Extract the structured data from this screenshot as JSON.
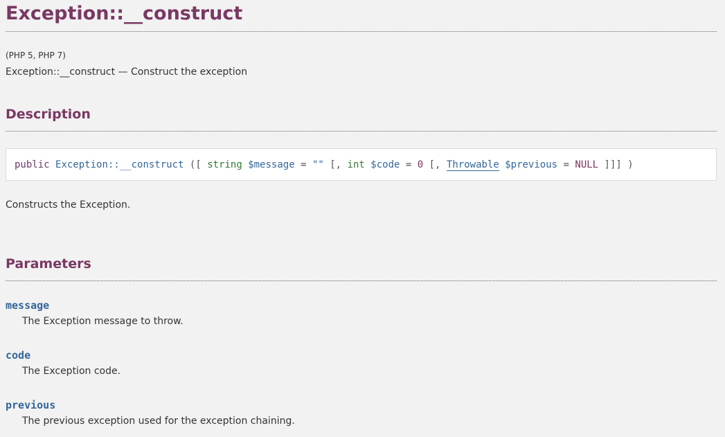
{
  "title": "Exception::__construct",
  "version": "(PHP 5, PHP 7)",
  "refpurpose": "Exception::__construct — Construct the exception",
  "sections": {
    "description": "Description",
    "parameters": "Parameters"
  },
  "synopsis": {
    "modifier": "public",
    "method": "Exception::__construct",
    "open": "([",
    "p1_type": "string",
    "p1_var": "$message",
    "p1_eq": "=",
    "p1_default": "\"\"",
    "sep1": "[,",
    "p2_type": "int",
    "p2_var": "$code",
    "p2_eq": "=",
    "p2_default": "0",
    "sep2": "[,",
    "p3_type": "Throwable",
    "p3_var": "$previous",
    "p3_eq": "=",
    "p3_default": "NULL",
    "close": "]]] )"
  },
  "description_text": "Constructs the Exception.",
  "parameters": [
    {
      "name": "message",
      "desc": "The Exception message to throw."
    },
    {
      "name": "code",
      "desc": "The Exception code."
    },
    {
      "name": "previous",
      "desc": "The previous exception used for the exception chaining."
    }
  ],
  "colors": {
    "heading": "#793862",
    "link": "#336699",
    "type": "#337a33",
    "background": "#f2f2f2"
  }
}
